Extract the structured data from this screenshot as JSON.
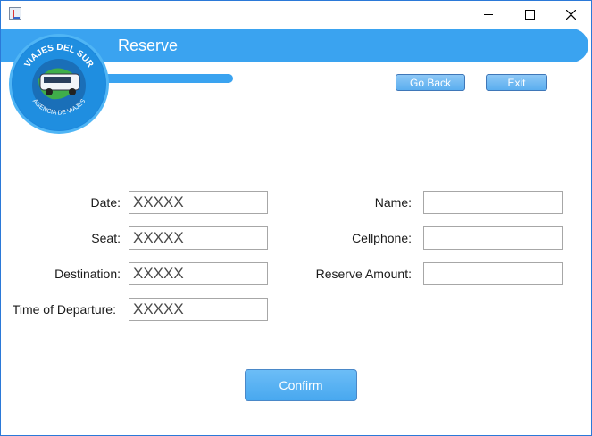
{
  "window": {
    "title": "",
    "controls": {
      "minimize": "minimize",
      "maximize": "maximize",
      "close": "close"
    }
  },
  "header": {
    "title": "Reserve",
    "logo": {
      "top_text": "VIAJES DEL SUR",
      "bottom_text": "AGENCIA DE VIAJES"
    }
  },
  "nav": {
    "go_back_label": "Go Back",
    "exit_label": "Exit"
  },
  "form": {
    "left": [
      {
        "label": "Date:",
        "value": "XXXXX"
      },
      {
        "label": "Seat:",
        "value": "XXXXX"
      },
      {
        "label": "Destination:",
        "value": "XXXXX"
      },
      {
        "label": "Time of Departure:",
        "value": "XXXXX"
      }
    ],
    "right": [
      {
        "label": "Name:",
        "value": ""
      },
      {
        "label": "Cellphone:",
        "value": ""
      },
      {
        "label": "Reserve Amount:",
        "value": ""
      }
    ]
  },
  "actions": {
    "confirm_label": "Confirm"
  },
  "colors": {
    "accent": "#3aa3f0",
    "border": "#2b79d8"
  }
}
